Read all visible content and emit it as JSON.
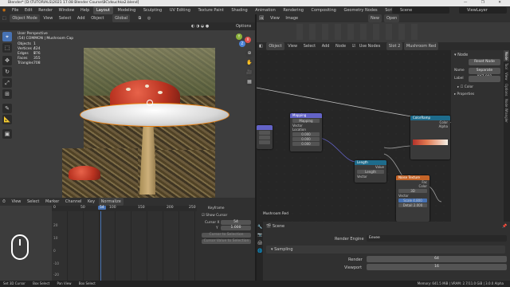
{
  "titlebar": {
    "text": "Blender* [D:\\TUTORIALS\\2021 17.08 Blender Course\\BC\\dsuchka2.blend]",
    "controls": "— ❐ ✕"
  },
  "menubar": {
    "menus": [
      "File",
      "Edit",
      "Render",
      "Window",
      "Help"
    ],
    "workspaces": [
      "Layout",
      "Modeling",
      "Sculpting",
      "UV Editing",
      "Texture Paint",
      "Shading",
      "Animation",
      "Rendering",
      "Compositing",
      "Geometry Nodes",
      "Scripting"
    ],
    "active_workspace": "Layout",
    "scene": "Scene",
    "view_layer": "ViewLayer"
  },
  "viewport": {
    "header_items": [
      "Object Mode",
      "View",
      "Select",
      "Add",
      "Object"
    ],
    "transform": "Global",
    "options": "Options",
    "overlay_title": "User Perspective",
    "overlay_collection": "(54) COMMON | Mushroom Cap",
    "stats": [
      {
        "label": "Objects",
        "value": "1 / 8"
      },
      {
        "label": "Vertices",
        "value": "424"
      },
      {
        "label": "Edges",
        "value": "776"
      },
      {
        "label": "Faces",
        "value": "355"
      },
      {
        "label": "Triangles",
        "value": "708"
      }
    ],
    "tools": [
      "cursor",
      "move",
      "rotate",
      "scale",
      "transform",
      "annotate",
      "measure",
      "add-cube"
    ]
  },
  "timeline": {
    "header_items": [
      "View",
      "Select",
      "Marker",
      "Channel",
      "Key"
    ],
    "mode": "Normalize",
    "ruler": [
      "0",
      "50",
      "100",
      "150",
      "200",
      "250"
    ],
    "current_frame": "54",
    "axis": [
      "20",
      "10",
      "0",
      "-10",
      "-20"
    ],
    "side_title": "Keyframe",
    "show_cursor": "Show Cursor",
    "cursor_x_label": "Cursor X",
    "cursor_x_value": "54",
    "cursor_y_label": "Y",
    "cursor_y_value": "1.000",
    "cursor_to_selection": "Cursor to Selection",
    "cursor_value_to_selection": "Cursor Value to Selection"
  },
  "node_editor": {
    "header_items": [
      "View",
      "Image"
    ],
    "new_label": "New",
    "open_label": "Open",
    "header2_items": [
      "Object",
      "View",
      "Select",
      "Add",
      "Node"
    ],
    "use_nodes": "Use Nodes",
    "slot": "Slot 2",
    "material": "Mushroom Red",
    "footer_label": "Mushroom Red",
    "nodes": {
      "mapping": {
        "title": "Mapping",
        "type": "Mapping",
        "fields": [
          "Vector",
          "Location",
          "0.000",
          "0.000",
          "0.000"
        ]
      },
      "length": {
        "title": "Length",
        "rows": [
          "Value",
          "Vector",
          "Length",
          "Vector"
        ]
      },
      "color_ramp": {
        "title": "ColorRamp",
        "mode": "RGB",
        "interp": "Linear",
        "pos": "0.327",
        "rows": [
          "Color",
          "Alpha",
          "Fac"
        ]
      },
      "noise": {
        "title": "Noise Texture",
        "rows": [
          "Fac",
          "Color",
          "3D",
          "Vector",
          "Scale",
          "Detail",
          "Roughness",
          "Distortion"
        ],
        "values": [
          "4.800",
          "2.000",
          "0.500",
          "0.000"
        ]
      }
    },
    "sidebar": {
      "section": "Node",
      "reset": "Reset Node",
      "name_label": "Name",
      "name_value": "Separate XYZ.001",
      "label_label": "Label",
      "color": "Color",
      "properties": "Properties"
    },
    "tabs": [
      "Node",
      "Tool",
      "View",
      "Options",
      "Node Wrangler"
    ]
  },
  "properties": {
    "header": "Scene",
    "render_engine_label": "Render Engine",
    "render_engine_value": "Eevee",
    "sampling_label": "Sampling",
    "render_label": "Render",
    "render_value": "64",
    "viewport_label": "Viewport",
    "viewport_value": "16"
  },
  "statusbar": {
    "items": [
      "Set 3D Cursor",
      "Box Select",
      "Pan View",
      "Box Select"
    ],
    "version": "Memory: 641.5 MiB | VRAM: 2.7/11.0 GiB | 3.0.0 Alpha"
  }
}
